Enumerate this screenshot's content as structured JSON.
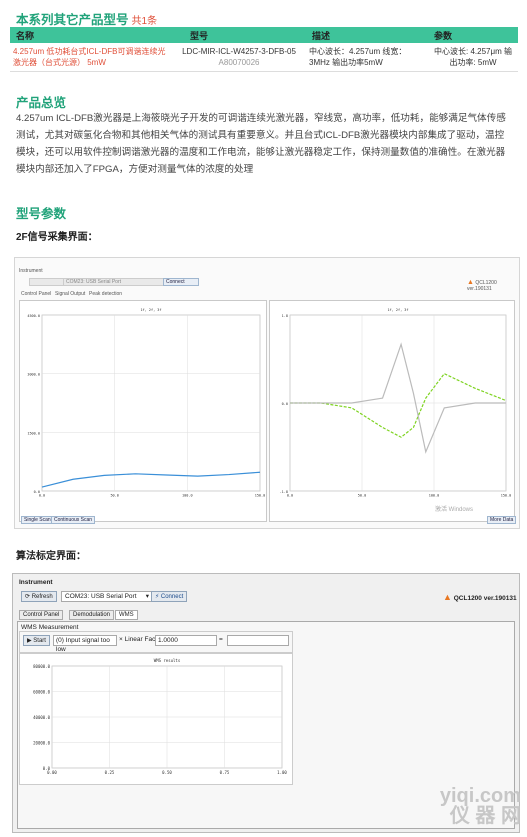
{
  "related": {
    "title": "本系列其它产品型号",
    "count": "共1条",
    "headers": [
      "名称",
      "型号",
      "描述",
      "参数"
    ],
    "row": {
      "name": "4.257um 低功耗台式ICL-DFB可调谐连续光激光器（台式光源） 5mW",
      "model": "LDC-MIR-ICL-W4257-3-DFB-05",
      "code": "A80070026",
      "desc": "中心波长：4.257um 线宽：3MHz 输出功率5mW",
      "params": "中心波长: 4.257μm 输出功率: 5mW"
    }
  },
  "overview": {
    "title": "产品总览",
    "text": "4.257um ICL-DFB激光器是上海筱晓光子开发的可调谐连续光激光器，窄线宽，高功率，低功耗，能够满足气体传感测试，尤其对碳氢化合物和其他相关气体的测试具有重要意义。并且台式ICL-DFB激光器模块内部集成了驱动，温控模块，还可以用软件控制调谐激光器的温度和工作电流，能够让激光器稳定工作，保持测量数值的准确性。在激光器模块内部还加入了FPGA，方便对测量气体的浓度的处理"
  },
  "params": {
    "title": "型号参数",
    "fig1_caption": "2F信号采集界面：",
    "fig2_caption": "算法标定界面："
  },
  "shot1": {
    "group": "Instrument",
    "port": "COM23: USB Serial Port",
    "connect": "Connect",
    "version": "QCL1200 ver.190131",
    "tabs": [
      "Control Panel",
      "Signal Output",
      "Peak detection"
    ],
    "left_title": "1f, 2f, 3f",
    "right_title": "1f, 2f, 3f",
    "single_scan": "Single Scan",
    "cont_scan": "Continuous Scan",
    "more_data": "More Data",
    "win_watermark": "激活 Windows",
    "left_yticks": [
      "4500.0",
      "3000.0",
      "1500.0",
      "0.0"
    ],
    "right_yticks": [
      "1.8",
      "0.0",
      "-1.8"
    ],
    "xticks": [
      "0.0",
      "50.0",
      "100.0",
      "150.0"
    ]
  },
  "shot2": {
    "group": "Instrument",
    "refresh": "Refresh",
    "port": "COM23: USB Serial Port",
    "connect": "Connect",
    "version": "QCL1200 ver.190131",
    "tabs": [
      "Control Panel",
      "Demodulation",
      "WMS"
    ],
    "section": "WMS Measurement",
    "start": "Start",
    "status": "(0) Input signal too low",
    "factor_label": "Linear Factor",
    "factor_value": "1.0000",
    "equals": "=",
    "chart_title": "WMS results",
    "yticks": [
      "80000.0",
      "60000.0",
      "40000.0",
      "20000.0",
      "0.0"
    ],
    "xticks": [
      "0.00",
      "0.25",
      "0.50",
      "0.75",
      "1.00"
    ]
  },
  "watermark": {
    "line1": "yiqi.com",
    "line2": "仪 器 网"
  },
  "chart_data": [
    {
      "type": "line",
      "title": "1f, 2f, 3f",
      "x": [
        0,
        25,
        50,
        75,
        100,
        125,
        150,
        175
      ],
      "series": [
        {
          "values": [
            100,
            300,
            400,
            440,
            410,
            380,
            420,
            480
          ]
        }
      ],
      "ylim": [
        0,
        4500
      ],
      "grid": true
    },
    {
      "type": "line",
      "title": "1f, 2f, 3f",
      "x": [
        0,
        25,
        50,
        75,
        90,
        100,
        110,
        125,
        150,
        175
      ],
      "series": [
        {
          "color": "#7ed321",
          "values": [
            0,
            0,
            -0.1,
            -0.5,
            -0.7,
            -0.5,
            0.1,
            0.6,
            0.3,
            0.05
          ]
        },
        {
          "color": "#bbbbbb",
          "values": [
            0,
            0,
            0,
            0.1,
            1.2,
            0.2,
            -1.0,
            -0.1,
            0,
            0
          ]
        }
      ],
      "ylim": [
        -1.8,
        1.8
      ],
      "grid": true
    },
    {
      "type": "line",
      "title": "WMS results",
      "x": [],
      "series": [],
      "xlim": [
        0,
        1
      ],
      "ylim": [
        0,
        80000
      ],
      "grid": true
    }
  ],
  "colors": {
    "accent": "#21a37a",
    "table_header": "#3ec39a",
    "link_red": "#e0503a"
  }
}
